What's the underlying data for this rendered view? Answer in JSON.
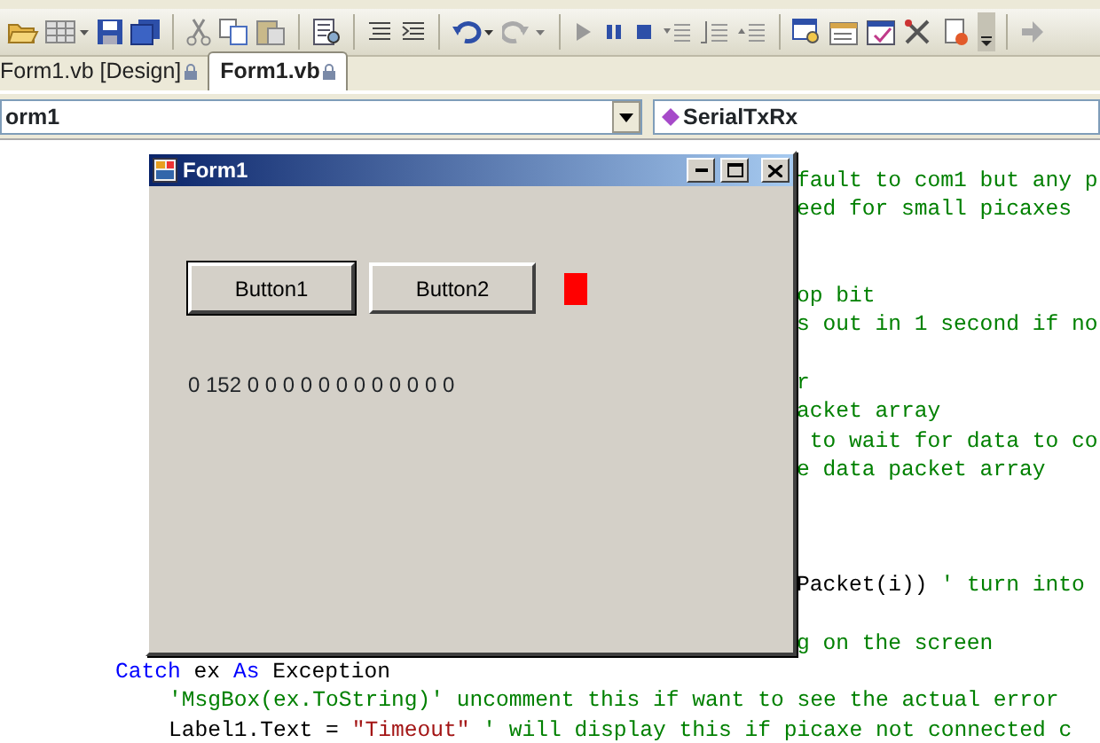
{
  "tabs": [
    {
      "label": "Form1.vb [Design]",
      "selected": false
    },
    {
      "label": "Form1.vb",
      "selected": true
    }
  ],
  "dropdowns": {
    "object": "orm1",
    "member": "SerialTxRx"
  },
  "code_lines": [
    {
      "kind": "partial",
      "segments": [
        {
          "kind": "comment",
          "text": "fault to com1 but any p"
        }
      ]
    },
    {
      "kind": "partial",
      "segments": [
        {
          "kind": "comment",
          "text": "eed for small picaxes"
        }
      ]
    },
    {
      "kind": "blank"
    },
    {
      "kind": "blank"
    },
    {
      "kind": "partial",
      "segments": [
        {
          "kind": "comment",
          "text": "op bit"
        }
      ]
    },
    {
      "kind": "partial",
      "segments": [
        {
          "kind": "comment",
          "text": "s out in 1 second if no"
        }
      ]
    },
    {
      "kind": "blank"
    },
    {
      "kind": "partial",
      "segments": [
        {
          "kind": "comment",
          "text": "r"
        }
      ]
    },
    {
      "kind": "partial",
      "segments": [
        {
          "kind": "comment",
          "text": "acket array"
        }
      ]
    },
    {
      "kind": "partial",
      "segments": [
        {
          "kind": "comment",
          "text": " to wait for data to co"
        }
      ]
    },
    {
      "kind": "partial",
      "segments": [
        {
          "kind": "comment",
          "text": "e data packet array"
        }
      ]
    },
    {
      "kind": "blank"
    },
    {
      "kind": "blank"
    },
    {
      "kind": "blank"
    },
    {
      "kind": "partial",
      "segments": [
        {
          "kind": "plain",
          "text": "Packet(i)) "
        },
        {
          "kind": "comment",
          "text": "' turn into"
        }
      ]
    },
    {
      "kind": "blank"
    },
    {
      "kind": "partial",
      "segments": [
        {
          "kind": "comment",
          "text": "g on the screen"
        }
      ]
    },
    {
      "kind": "indent1",
      "segments": [
        {
          "kind": "keyword",
          "text": "Catch"
        },
        {
          "kind": "plain",
          "text": " ex "
        },
        {
          "kind": "keyword",
          "text": "As"
        },
        {
          "kind": "plain",
          "text": " Exception"
        }
      ]
    },
    {
      "kind": "indent2",
      "segments": [
        {
          "kind": "comment",
          "text": "'MsgBox(ex.ToString)' uncomment this if want to see the actual error"
        }
      ]
    },
    {
      "kind": "indent2",
      "segments": [
        {
          "kind": "plain",
          "text": "Label1.Text = "
        },
        {
          "kind": "string",
          "text": "\"Timeout\""
        },
        {
          "kind": "comment",
          "text": " ' will display this if picaxe not connected c"
        }
      ]
    }
  ],
  "form_window": {
    "title": "Form1",
    "buttons": [
      {
        "label": "Button1",
        "focused": true
      },
      {
        "label": "Button2",
        "focused": false
      }
    ],
    "indicator": {
      "color": "#ff0000"
    },
    "label": "0 152 0 0 0 0 0 0 0 0 0 0 0 0"
  }
}
